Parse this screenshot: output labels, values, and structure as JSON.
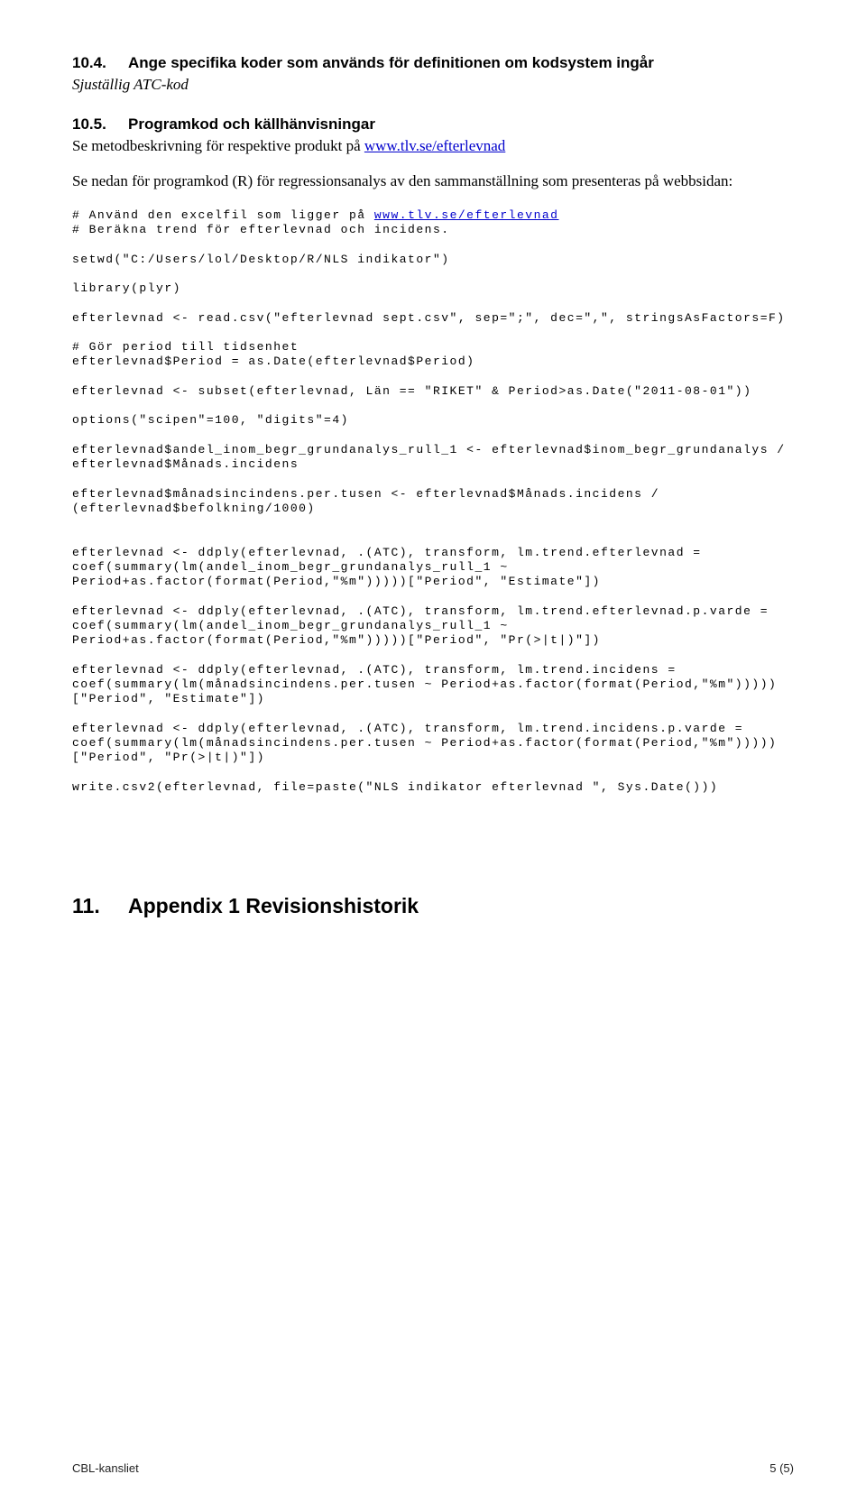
{
  "sections": {
    "s10_4": {
      "num": "10.4.",
      "title": "Ange specifika koder som används för definitionen om kodsystem ingår",
      "body_italic": "Sjuställig ATC-kod"
    },
    "s10_5": {
      "num": "10.5.",
      "title": "Programkod och källhänvisningar",
      "line1_pre": "Se metodbeskrivning för respektive produkt på ",
      "link1": "www.tlv.se/efterlevnad",
      "line2": "Se nedan för programkod (R) för regressionsanalys av den sammanställning som presenteras på webbsidan:"
    },
    "s11": {
      "num": "11.",
      "title": "Appendix 1 Revisionshistorik"
    }
  },
  "code": {
    "c01a": "# Använd den excelfil som ligger på ",
    "c01b": "www.tlv.se/efterlevnad",
    "c02": "# Beräkna trend för efterlevnad och incidens.",
    "c03": "setwd(\"C:/Users/lol/Desktop/R/NLS indikator\")",
    "c04": "library(plyr)",
    "c05": "efterlevnad <- read.csv(\"efterlevnad sept.csv\", sep=\";\", dec=\",\", stringsAsFactors=F)",
    "c06": "# Gör period till tidsenhet",
    "c07": "efterlevnad$Period = as.Date(efterlevnad$Period)",
    "c08": "efterlevnad <- subset(efterlevnad, Län == \"RIKET\" & Period>as.Date(\"2011-08-01\"))",
    "c09": "options(\"scipen\"=100, \"digits\"=4)",
    "c10": "efterlevnad$andel_inom_begr_grundanalys_rull_1 <- efterlevnad$inom_begr_grundanalys / efterlevnad$Månads.incidens",
    "c11": "efterlevnad$månadsincindens.per.tusen <- efterlevnad$Månads.incidens / (efterlevnad$befolkning/1000)",
    "c12": "efterlevnad <- ddply(efterlevnad, .(ATC), transform, lm.trend.efterlevnad = coef(summary(lm(andel_inom_begr_grundanalys_rull_1 ~ Period+as.factor(format(Period,\"%m\")))))[\"Period\", \"Estimate\"])",
    "c13": "efterlevnad <- ddply(efterlevnad, .(ATC), transform, lm.trend.efterlevnad.p.varde = coef(summary(lm(andel_inom_begr_grundanalys_rull_1 ~ Period+as.factor(format(Period,\"%m\")))))[\"Period\", \"Pr(>|t|)\"])",
    "c14": "efterlevnad <- ddply(efterlevnad, .(ATC), transform, lm.trend.incidens = coef(summary(lm(månadsincindens.per.tusen ~ Period+as.factor(format(Period,\"%m\")))))[\"Period\", \"Estimate\"])",
    "c15": "efterlevnad <- ddply(efterlevnad, .(ATC), transform, lm.trend.incidens.p.varde = coef(summary(lm(månadsincindens.per.tusen ~ Period+as.factor(format(Period,\"%m\")))))[\"Period\", \"Pr(>|t|)\"])",
    "c16": "write.csv2(efterlevnad, file=paste(\"NLS indikator efterlevnad \", Sys.Date()))"
  },
  "footer": {
    "left": "CBL-kansliet",
    "right": "5 (5)"
  }
}
